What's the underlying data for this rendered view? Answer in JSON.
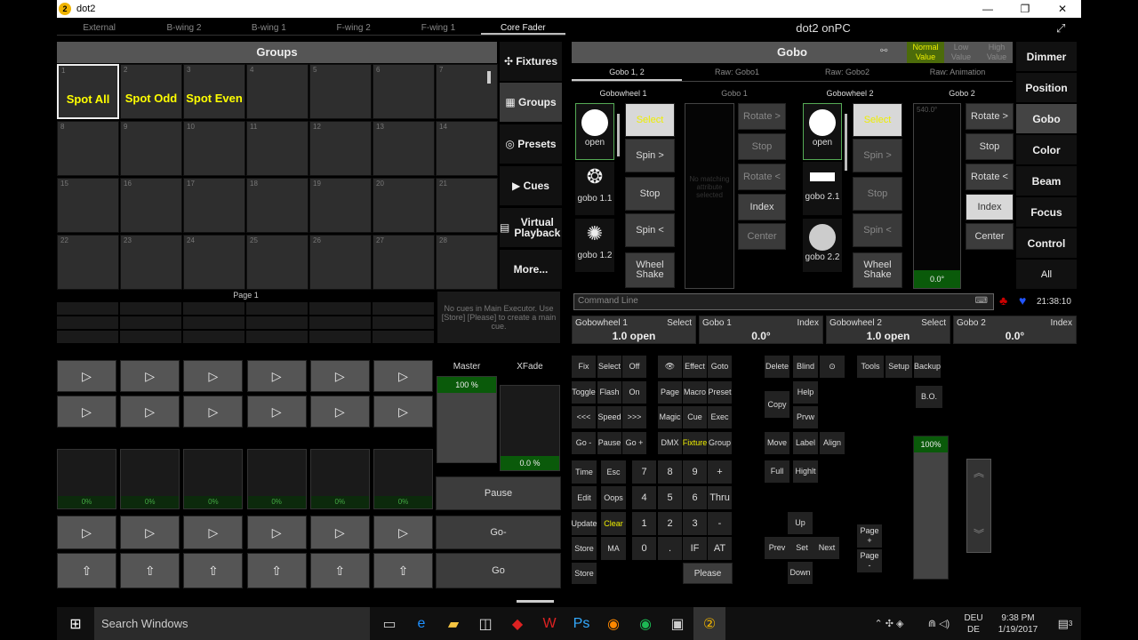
{
  "window": {
    "title": "dot2",
    "min": "—",
    "max": "❐",
    "close": "✕"
  },
  "topnav": [
    "External",
    "B-wing 2",
    "B-wing 1",
    "F-wing 2",
    "F-wing 1",
    "Core Fader"
  ],
  "groups": {
    "title": "Groups",
    "cells": [
      {
        "n": "1",
        "label": "Spot All"
      },
      {
        "n": "2",
        "label": "Spot Odd"
      },
      {
        "n": "3",
        "label": "Spot Even"
      },
      {
        "n": "4",
        "label": ""
      },
      {
        "n": "5",
        "label": ""
      },
      {
        "n": "6",
        "label": ""
      },
      {
        "n": "7",
        "label": ""
      },
      {
        "n": "8",
        "label": ""
      },
      {
        "n": "9",
        "label": ""
      },
      {
        "n": "10",
        "label": ""
      },
      {
        "n": "11",
        "label": ""
      },
      {
        "n": "12",
        "label": ""
      },
      {
        "n": "13",
        "label": ""
      },
      {
        "n": "14",
        "label": ""
      },
      {
        "n": "15",
        "label": ""
      },
      {
        "n": "16",
        "label": ""
      },
      {
        "n": "17",
        "label": ""
      },
      {
        "n": "18",
        "label": ""
      },
      {
        "n": "19",
        "label": ""
      },
      {
        "n": "20",
        "label": ""
      },
      {
        "n": "21",
        "label": ""
      },
      {
        "n": "22",
        "label": ""
      },
      {
        "n": "23",
        "label": ""
      },
      {
        "n": "24",
        "label": ""
      },
      {
        "n": "25",
        "label": ""
      },
      {
        "n": "26",
        "label": ""
      },
      {
        "n": "27",
        "label": ""
      },
      {
        "n": "28",
        "label": ""
      }
    ]
  },
  "sidebar": [
    "Fixtures",
    "Groups",
    "Presets",
    "Cues",
    "Virtual Playback",
    "More..."
  ],
  "page_label": "Page 1",
  "no_cues": "No cues in Main Executor. Use [Store] [Please] to create a main cue.",
  "master": {
    "label": "Master",
    "value": "100 %"
  },
  "xfade": {
    "label": "XFade",
    "value": "0.0 %"
  },
  "fader_pct": "0%",
  "main_buttons": {
    "pause": "Pause",
    "gominus": "Go-",
    "go": "Go"
  },
  "app_title": "dot2 onPC",
  "gobo": {
    "title": "Gobo",
    "modes": [
      "Normal Value",
      "Low Value",
      "High Value"
    ],
    "tabs": [
      "Gobo 1, 2",
      "Raw: Gobo1",
      "Raw: Gobo2",
      "Raw: Animation"
    ],
    "cols": [
      "Gobowheel 1",
      "Gobo 1",
      "Gobowheel 2",
      "Gobo 2"
    ],
    "w1": [
      "open",
      "gobo 1.1",
      "gobo 1.2"
    ],
    "w2": [
      "open",
      "gobo 2.1",
      "gobo 2.2"
    ],
    "wheel_btns": [
      "Select",
      "Spin >",
      "Stop",
      "Spin <",
      "Wheel Shake"
    ],
    "rot_btns": [
      "Rotate >",
      "Stop",
      "Rotate <",
      "Index",
      "Center"
    ],
    "no_attr": "No matching attribute selected",
    "val1": "540.0°",
    "val2": "0.0°"
  },
  "features": [
    "Dimmer",
    "Position",
    "Gobo",
    "Color",
    "Beam",
    "Focus",
    "Control",
    "All"
  ],
  "cmdline": "Command Line",
  "clock": "21:38:10",
  "attr": [
    {
      "t": "Gobowheel 1",
      "m": "Select",
      "v": "1.0 open"
    },
    {
      "t": "Gobo 1",
      "m": "Index",
      "v": "0.0°"
    },
    {
      "t": "Gobowheel 2",
      "m": "Select",
      "v": "1.0 open"
    },
    {
      "t": "Gobo 2",
      "m": "Index",
      "v": "0.0°"
    }
  ],
  "keys": {
    "r1": [
      "Fix",
      "Select",
      "Off",
      "👁",
      "Effect",
      "Goto"
    ],
    "r2": [
      "Toggle",
      "Flash",
      "On",
      "Page",
      "Macro",
      "Preset"
    ],
    "r3": [
      "<<<",
      "Speed",
      ">>>",
      "Magic",
      "Cue",
      "Exec"
    ],
    "r4": [
      "Go -",
      "Pause",
      "Go +",
      "DMX",
      "Fixture",
      "Group"
    ],
    "num": [
      "Time",
      "Esc",
      "7",
      "8",
      "9",
      "+",
      "Edit",
      "Oops",
      "4",
      "5",
      "6",
      "Thru",
      "Update",
      "Clear",
      "1",
      "2",
      "3",
      "-",
      "Store",
      "MA",
      "0",
      ".",
      "IF",
      "AT"
    ],
    "please": "Please",
    "col3": [
      "Delete",
      "Blind",
      "⊙",
      "Copy",
      "Help",
      "Prvw",
      "Move",
      "Label",
      "Align",
      "Full",
      "Highlt"
    ],
    "tools": [
      "Tools",
      "Setup",
      "Backup"
    ],
    "bo": "B.O.",
    "nav": [
      "Up",
      "Prev",
      "Set",
      "Next",
      "Down"
    ],
    "pageup": "Page +",
    "pagedn": "Page -",
    "grand": "100%"
  },
  "taskbar": {
    "search": "Search Windows",
    "lang1": "DEU",
    "lang2": "DE",
    "time": "9:38 PM",
    "date": "1/19/2017",
    "notif": "3"
  }
}
